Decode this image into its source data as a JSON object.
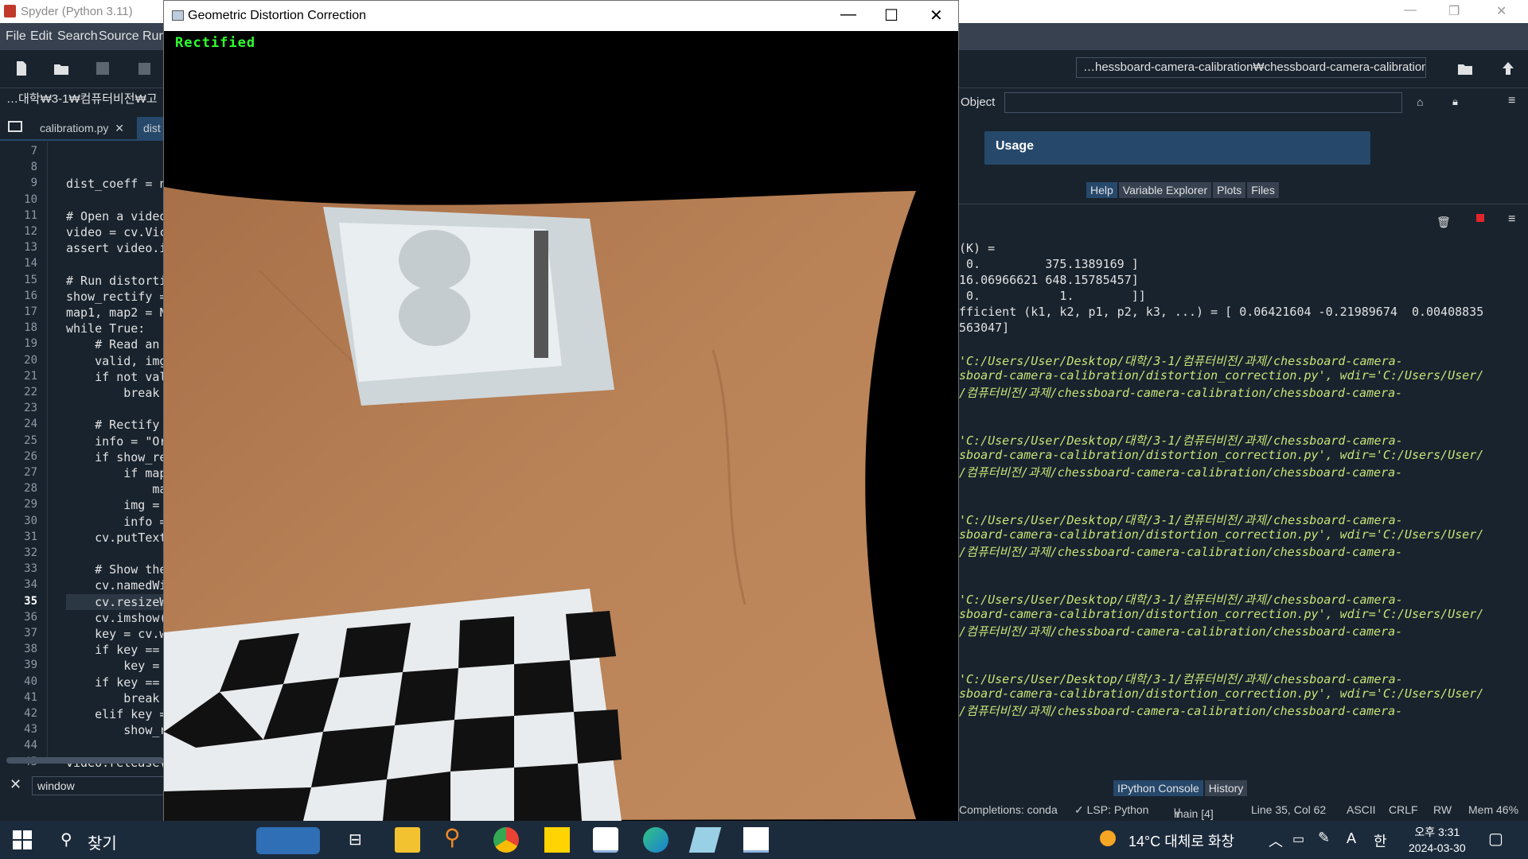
{
  "spyder": {
    "title": "Spyder (Python 3.11)",
    "menu": [
      "File",
      "Edit",
      "Search",
      "Source",
      "Run"
    ],
    "path": "…hessboard-camera-calibration₩chessboard-camera-calibration",
    "breadcrumb": "…대학₩3-1₩컴퓨터비전₩고",
    "tabs": [
      "calibratiom.py",
      "dist"
    ],
    "find_value": "window",
    "object_label": "Object",
    "usage_title": "Usage",
    "help_tabs": [
      "Help",
      "Variable Explorer",
      "Plots",
      "Files"
    ],
    "console_tabs": [
      "IPython Console",
      "History"
    ]
  },
  "editor": {
    "lines": [
      {
        "n": "7",
        "code": ""
      },
      {
        "n": "8",
        "code": ""
      },
      {
        "n": "9",
        "code": "dist_coeff = n"
      },
      {
        "n": "10",
        "code": ""
      },
      {
        "n": "11",
        "code": "# Open a video"
      },
      {
        "n": "12",
        "code": "video = cv.Vic"
      },
      {
        "n": "13",
        "code": "assert video.i"
      },
      {
        "n": "14",
        "code": ""
      },
      {
        "n": "15",
        "code": "# Run distorti"
      },
      {
        "n": "16",
        "code": "show_rectify ="
      },
      {
        "n": "17",
        "code": "map1, map2 = N"
      },
      {
        "n": "18",
        "code": "while True:"
      },
      {
        "n": "19",
        "code": "    # Read an"
      },
      {
        "n": "20",
        "code": "    valid, img"
      },
      {
        "n": "21",
        "code": "    if not val"
      },
      {
        "n": "22",
        "code": "        break"
      },
      {
        "n": "23",
        "code": ""
      },
      {
        "n": "24",
        "code": "    # Rectify"
      },
      {
        "n": "25",
        "code": "    info = \"Or"
      },
      {
        "n": "26",
        "code": "    if show_re"
      },
      {
        "n": "27",
        "code": "        if map"
      },
      {
        "n": "28",
        "code": "            ma"
      },
      {
        "n": "29",
        "code": "        img ="
      },
      {
        "n": "30",
        "code": "        info ="
      },
      {
        "n": "31",
        "code": "    cv.putText"
      },
      {
        "n": "32",
        "code": ""
      },
      {
        "n": "33",
        "code": "    # Show the"
      },
      {
        "n": "34",
        "code": "    cv.namedWi"
      },
      {
        "n": "35",
        "code": "    cv.resizeW"
      },
      {
        "n": "36",
        "code": "    cv.imshow("
      },
      {
        "n": "37",
        "code": "    key = cv.w"
      },
      {
        "n": "38",
        "code": "    if key =="
      },
      {
        "n": "39",
        "code": "        key ="
      },
      {
        "n": "40",
        "code": "    if key =="
      },
      {
        "n": "41",
        "code": "        break"
      },
      {
        "n": "42",
        "code": "    elif key ="
      },
      {
        "n": "43",
        "code": "        show_r"
      },
      {
        "n": "44",
        "code": ""
      },
      {
        "n": "45",
        "code": "video.release("
      }
    ],
    "current_line": "35"
  },
  "console": {
    "lines": [
      {
        "t": "(K) =",
        "k": "path"
      },
      {
        "t": " 0.         375.1389169 ]",
        "k": "path"
      },
      {
        "t": "16.06966621 648.15785457]",
        "k": "path"
      },
      {
        "t": " 0.           1.        ]]",
        "k": "path"
      },
      {
        "t": "fficient (k1, k2, p1, p2, k3, ...) = [ 0.06421604 -0.21989674  0.00408835",
        "k": "path"
      },
      {
        "t": "563047]",
        "k": "path"
      },
      {
        "t": "",
        "k": "path"
      },
      {
        "t": "'C:/Users/User/Desktop/대학/3-1/컴퓨터비전/과제/chessboard-camera-",
        "k": "green"
      },
      {
        "t": "sboard-camera-calibration/distortion_correction.py', wdir='C:/Users/User/",
        "k": "green"
      },
      {
        "t": "/컴퓨터비전/과제/chessboard-camera-calibration/chessboard-camera-",
        "k": "green"
      },
      {
        "t": "",
        "k": "path"
      },
      {
        "t": "",
        "k": "path"
      },
      {
        "t": "'C:/Users/User/Desktop/대학/3-1/컴퓨터비전/과제/chessboard-camera-",
        "k": "green"
      },
      {
        "t": "sboard-camera-calibration/distortion_correction.py', wdir='C:/Users/User/",
        "k": "green"
      },
      {
        "t": "/컴퓨터비전/과제/chessboard-camera-calibration/chessboard-camera-",
        "k": "green"
      },
      {
        "t": "",
        "k": "path"
      },
      {
        "t": "",
        "k": "path"
      },
      {
        "t": "'C:/Users/User/Desktop/대학/3-1/컴퓨터비전/과제/chessboard-camera-",
        "k": "green"
      },
      {
        "t": "sboard-camera-calibration/distortion_correction.py', wdir='C:/Users/User/",
        "k": "green"
      },
      {
        "t": "/컴퓨터비전/과제/chessboard-camera-calibration/chessboard-camera-",
        "k": "green"
      },
      {
        "t": "",
        "k": "path"
      },
      {
        "t": "",
        "k": "path"
      },
      {
        "t": "'C:/Users/User/Desktop/대학/3-1/컴퓨터비전/과제/chessboard-camera-",
        "k": "green"
      },
      {
        "t": "sboard-camera-calibration/distortion_correction.py', wdir='C:/Users/User/",
        "k": "green"
      },
      {
        "t": "/컴퓨터비전/과제/chessboard-camera-calibration/chessboard-camera-",
        "k": "green"
      },
      {
        "t": "",
        "k": "path"
      },
      {
        "t": "",
        "k": "path"
      },
      {
        "t": "'C:/Users/User/Desktop/대학/3-1/컴퓨터비전/과제/chessboard-camera-",
        "k": "green"
      },
      {
        "t": "sboard-camera-calibration/distortion_correction.py', wdir='C:/Users/User/",
        "k": "green"
      },
      {
        "t": "/컴퓨터비전/과제/chessboard-camera-calibration/chessboard-camera-",
        "k": "green"
      }
    ]
  },
  "status": {
    "completions": "Completions: conda",
    "lsp": "✓ LSP: Python",
    "git": "main [4]",
    "position": "Line 35, Col 62",
    "encoding": "ASCII",
    "eol": "CRLF",
    "rw": "RW",
    "mem": "Mem 46%"
  },
  "cv_window": {
    "title": "Geometric Distortion Correction",
    "overlay_text": "Rectified"
  },
  "taskbar": {
    "search_label": "찾기",
    "weather": "14°C  대체로 화창",
    "ime": "A",
    "lang": "한",
    "time": "오후 3:31",
    "date": "2024-03-30"
  },
  "colors": {
    "background": "#19232d",
    "accent": "#26486b",
    "overlay_green": "#2fff2f"
  }
}
